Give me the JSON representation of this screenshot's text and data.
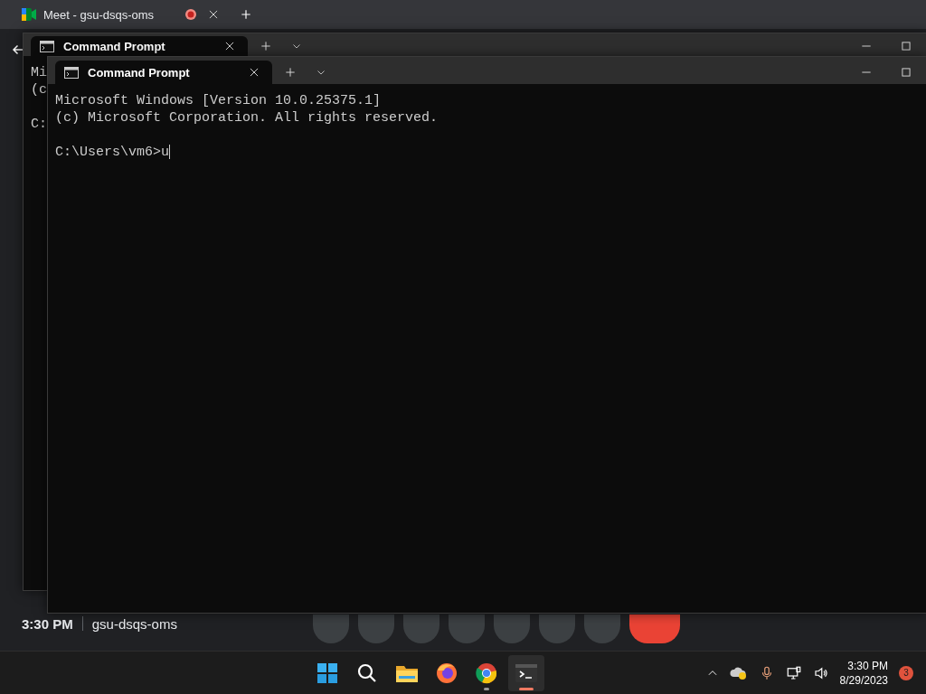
{
  "browser": {
    "tab": {
      "title": "Meet - gsu-dsqs-oms",
      "recording": true
    }
  },
  "back_terminal": {
    "tab_title": "Command Prompt",
    "lines": [
      "Mi",
      "(c"
    ],
    "prompt": "C:"
  },
  "meet_bar": {
    "time": "3:30 PM",
    "meeting_code": "gsu-dsqs-oms"
  },
  "terminal": {
    "tab_title": "Command Prompt",
    "lines": [
      "Microsoft Windows [Version 10.0.25375.1]",
      "(c) Microsoft Corporation. All rights reserved."
    ],
    "prompt": "C:\\Users\\vm6>",
    "input": "u"
  },
  "taskbar": {
    "apps": [
      {
        "kind": "start",
        "running": false,
        "selected": false
      },
      {
        "kind": "search",
        "running": false,
        "selected": false
      },
      {
        "kind": "files",
        "running": false,
        "selected": false
      },
      {
        "kind": "firefox",
        "running": false,
        "selected": false
      },
      {
        "kind": "chrome",
        "running": true,
        "selected": false
      },
      {
        "kind": "terminal",
        "running": true,
        "selected": true
      }
    ],
    "clock": {
      "time": "3:30 PM",
      "date": "8/29/2023"
    },
    "notification_count": "3"
  }
}
